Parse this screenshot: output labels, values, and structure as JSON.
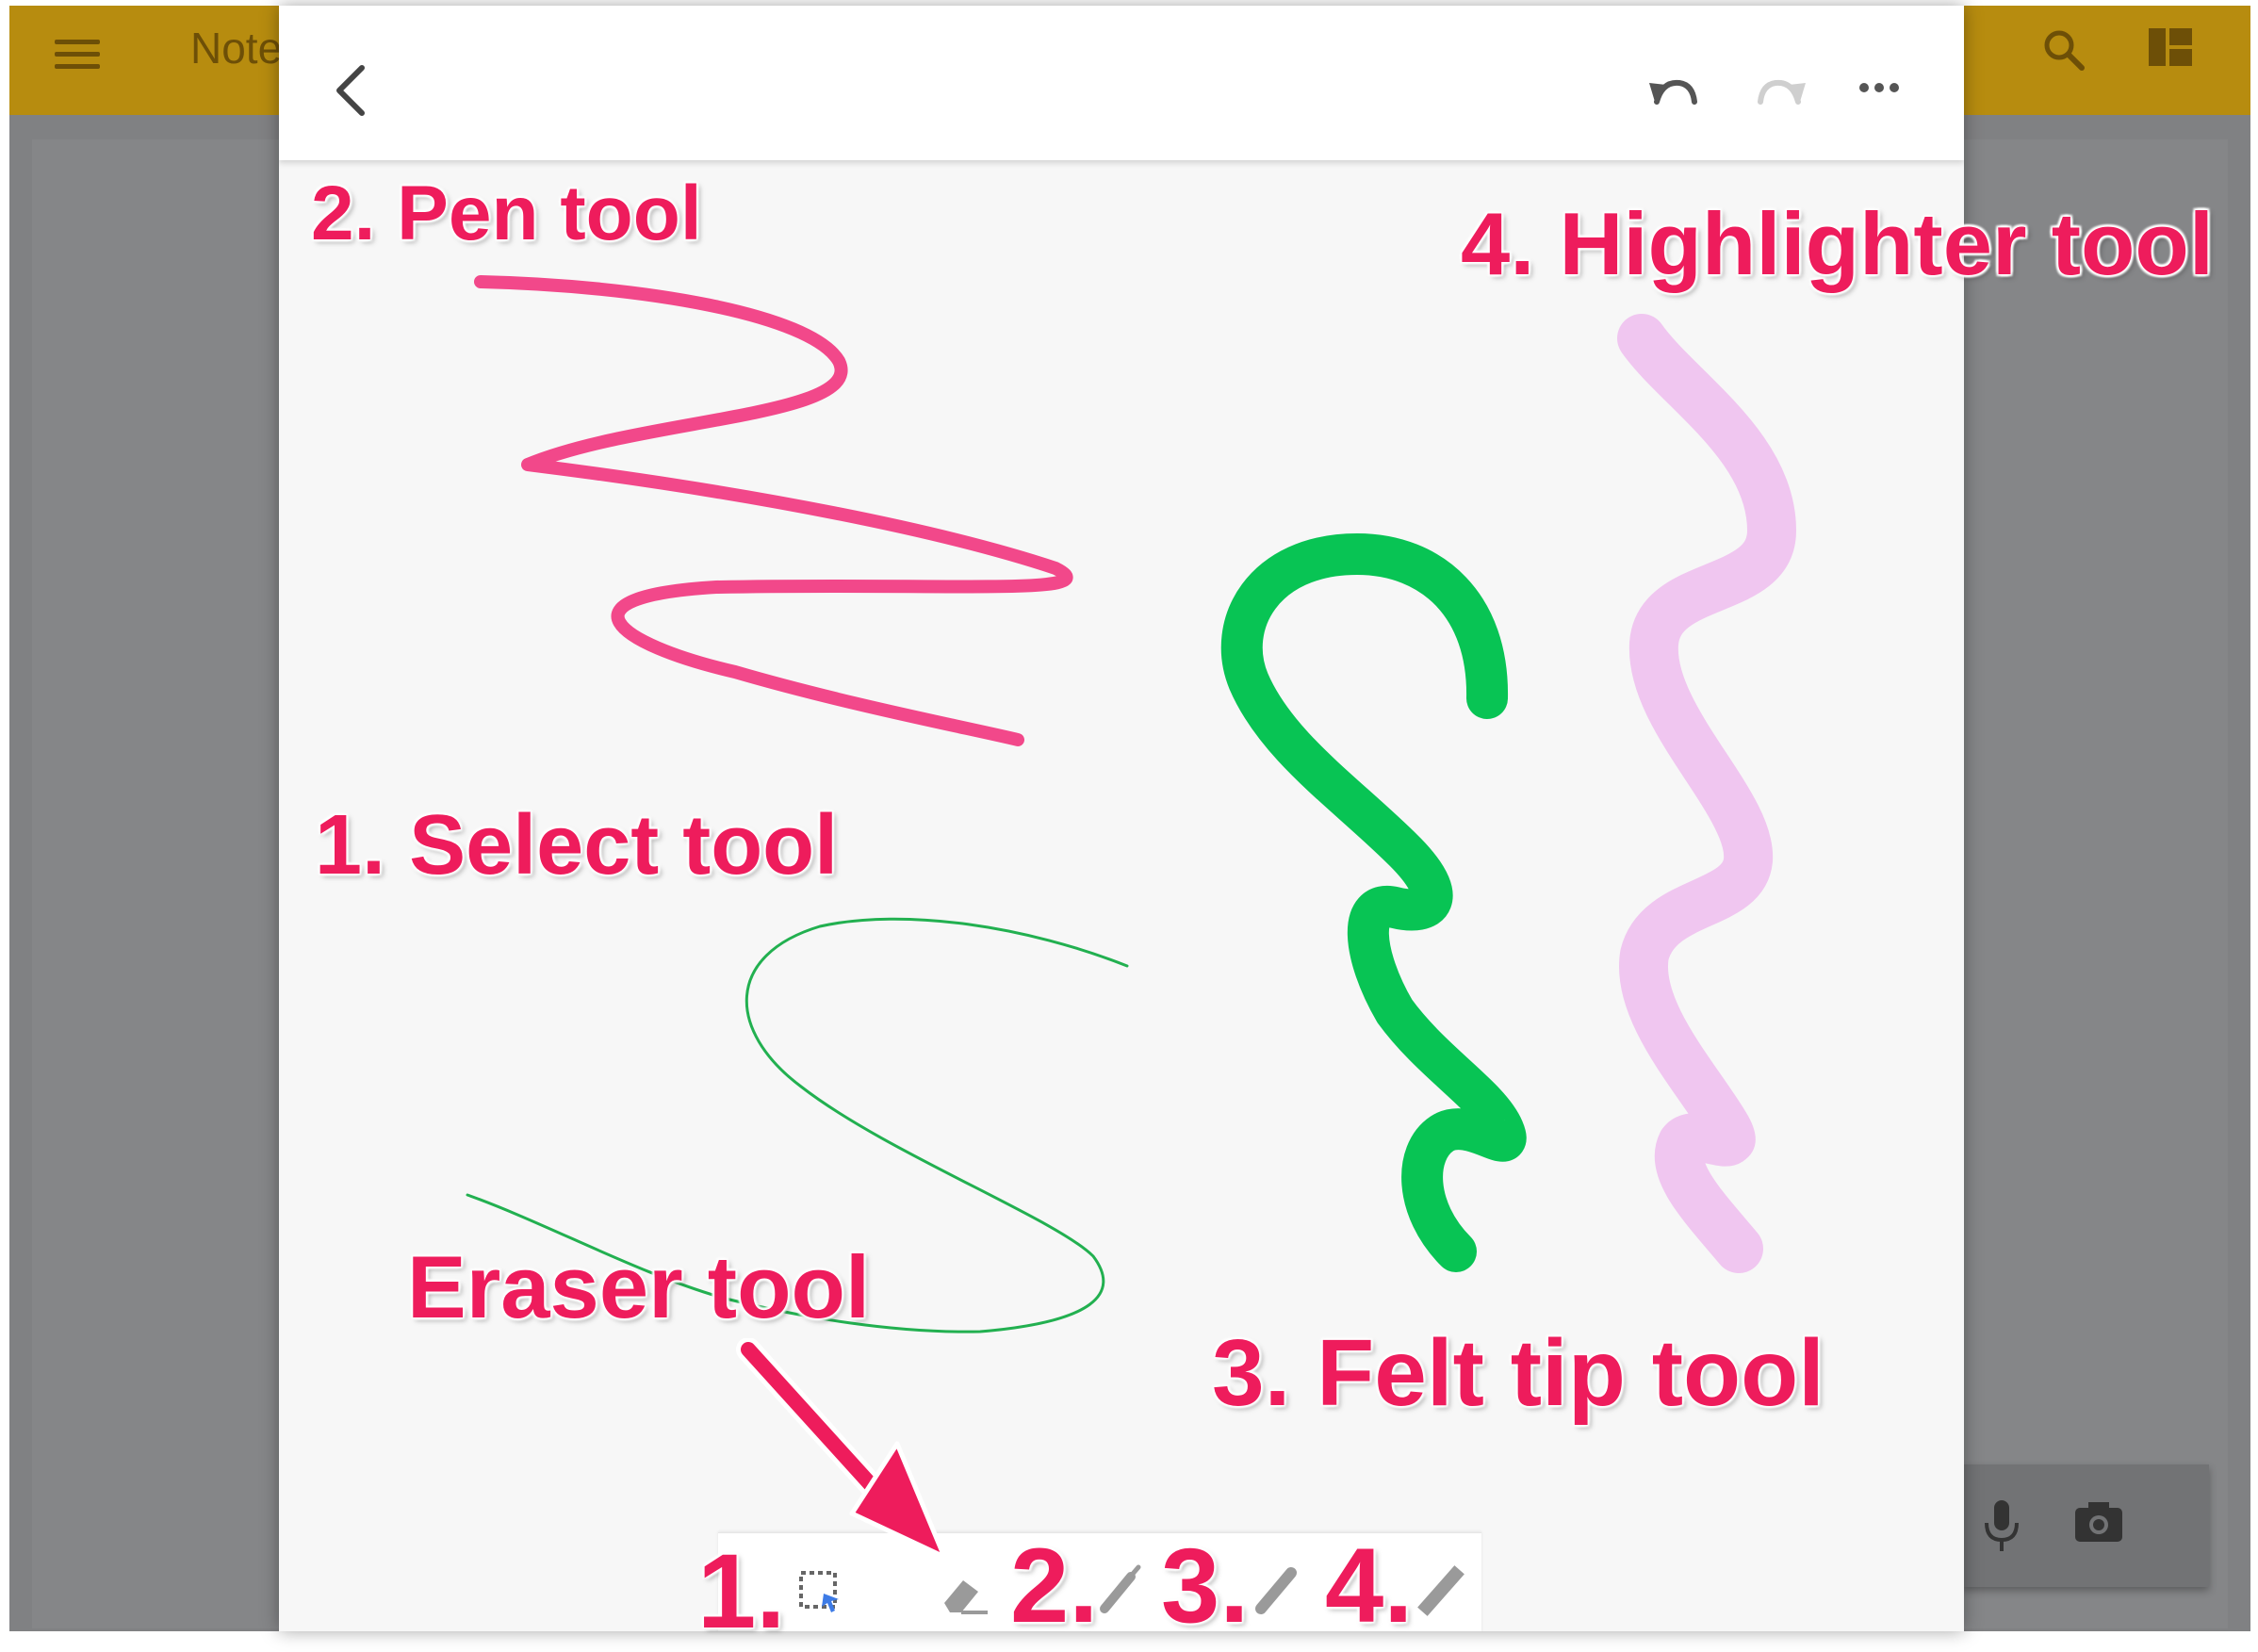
{
  "background_app": {
    "title": "Note",
    "menu_icon": "menu-icon",
    "search_icon": "search-icon",
    "layout_icon": "grid-layout-icon",
    "mic_icon": "microphone-icon",
    "camera_icon": "camera-icon"
  },
  "drawing_header": {
    "back_icon": "chevron-left-icon",
    "undo_icon": "undo-icon",
    "redo_icon": "redo-icon",
    "more_icon": "more-horizontal-icon"
  },
  "annotations": {
    "pen": "2. Pen tool",
    "highlighter": "4. Highlighter tool",
    "select": "1. Select tool",
    "eraser": "Eraser tool",
    "felt_tip": "3. Felt tip tool"
  },
  "toolbar": {
    "labels": [
      "1.",
      "2.",
      "3.",
      "4."
    ],
    "icons": [
      "select-icon",
      "eraser-icon",
      "pen-icon",
      "felt-tip-icon",
      "highlighter-icon"
    ]
  },
  "colors": {
    "app_bar": "#b78c0f",
    "annotation": "#ee1c5c",
    "pen_stroke": "#f2488a",
    "felt_tip_stroke": "#08c454",
    "highlighter_stroke": "#f0c6f0",
    "select_stroke": "#22b050",
    "select_accent": "#3d7be6"
  }
}
